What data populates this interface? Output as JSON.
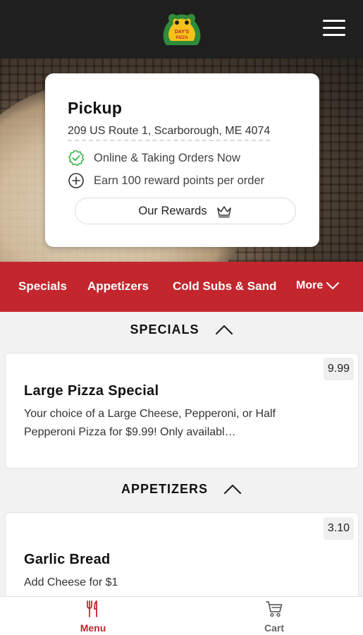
{
  "header": {
    "logo_text": "DAY'S PIZZA",
    "colors": {
      "bar": "#1f1f1f",
      "logo_green": "#2f8a3a",
      "logo_yellow": "#f4c21a"
    }
  },
  "pickup": {
    "title": "Pickup",
    "address": "209 US Route 1, Scarborough, ME 4074",
    "status": "Online & Taking Orders Now",
    "rewards_note": "Earn 100 reward points per order",
    "rewards_button": "Our Rewards"
  },
  "category_nav": {
    "items": [
      "Specials",
      "Appetizers",
      "Cold Subs & Sand"
    ],
    "more_label": "More",
    "color": "#c4262e"
  },
  "sections": [
    {
      "title": "SPECIALS",
      "items": [
        {
          "name": "Large Pizza Special",
          "price": "9.99",
          "description": "Your choice of a Large Cheese, Pepperoni, or Half Pepperoni Pizza for $9.99! Only availabl…"
        }
      ]
    },
    {
      "title": "APPETIZERS",
      "items": [
        {
          "name": "Garlic Bread",
          "price": "3.10",
          "description": "Add Cheese for $1"
        }
      ]
    }
  ],
  "bottom_nav": {
    "menu_label": "Menu",
    "cart_label": "Cart",
    "active_color": "#c4262e",
    "inactive_color": "#666666"
  }
}
